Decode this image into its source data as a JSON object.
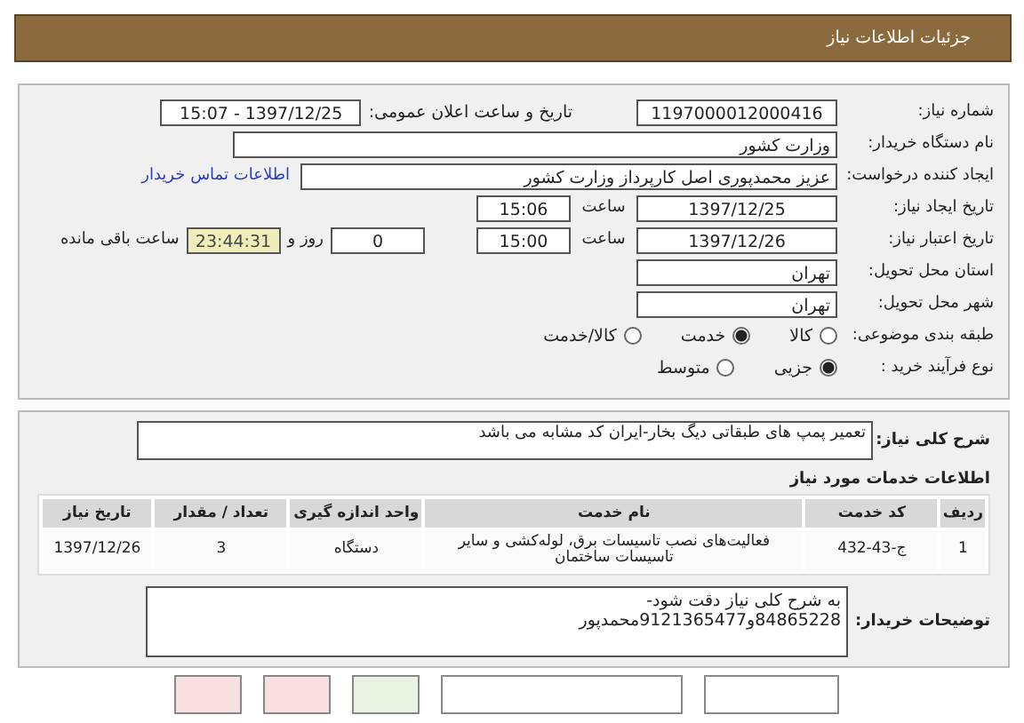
{
  "header": {
    "title": "جزئیات اطلاعات نیاز"
  },
  "fields": {
    "need_number": {
      "label": "شماره نیاز:",
      "value": "1197000012000416"
    },
    "announce": {
      "label": "تاریخ و ساعت اعلان عمومی:",
      "value": "1397/12/25 - 15:07"
    },
    "buyer": {
      "label": "نام دستگاه خریدار:",
      "value": "وزارت کشور"
    },
    "requester": {
      "label": "ایجاد کننده درخواست:",
      "value": "عزیز محمدپوری اصل کارپرداز وزارت کشور",
      "link": "اطلاعات تماس خریدار"
    },
    "created": {
      "label": "تاریخ ایجاد نیاز:",
      "date": "1397/12/25",
      "time_label": "ساعت",
      "time": "15:06"
    },
    "validity": {
      "label": "تاریخ اعتبار نیاز:",
      "date": "1397/12/26",
      "time_label": "ساعت",
      "time": "15:00",
      "days": "0",
      "days_label": "روز و",
      "remaining": "23:44:31",
      "remaining_label": "ساعت باقی مانده"
    },
    "province": {
      "label": "استان محل تحویل:",
      "value": "تهران"
    },
    "city": {
      "label": "شهر محل تحویل:",
      "value": "تهران"
    }
  },
  "category": {
    "label": "طبقه بندی موضوعی:",
    "options": [
      {
        "label": "کالا",
        "selected": false
      },
      {
        "label": "خدمت",
        "selected": true
      },
      {
        "label": "کالا/خدمت",
        "selected": false
      }
    ]
  },
  "process": {
    "label": "نوع فرآیند خرید :",
    "options": [
      {
        "label": "جزیی",
        "selected": true
      },
      {
        "label": "متوسط",
        "selected": false
      }
    ]
  },
  "description": {
    "label": "شرح کلی نیاز:",
    "value": "تعمیر پمپ های طبقاتی دیگ بخار-ایران کد مشابه می باشد"
  },
  "services": {
    "title": "اطلاعات خدمات مورد نیاز",
    "columns": [
      "ردیف",
      "کد خدمت",
      "نام خدمت",
      "واحد اندازه گیری",
      "تعداد / مقدار",
      "تاریخ نیاز"
    ],
    "rows": [
      [
        "1",
        "ج-43-432",
        "فعالیت‌های نصب تاسیسات برق، لوله‌کشی و سایر تاسیسات ساختمان",
        "دستگاه",
        "3",
        "1397/12/26"
      ]
    ]
  },
  "notes": {
    "label": "توضیحات خریدار:",
    "lines": [
      "به شرح کلی نیاز دقت شود-",
      "84865228و9121365477محمدپور"
    ]
  }
}
